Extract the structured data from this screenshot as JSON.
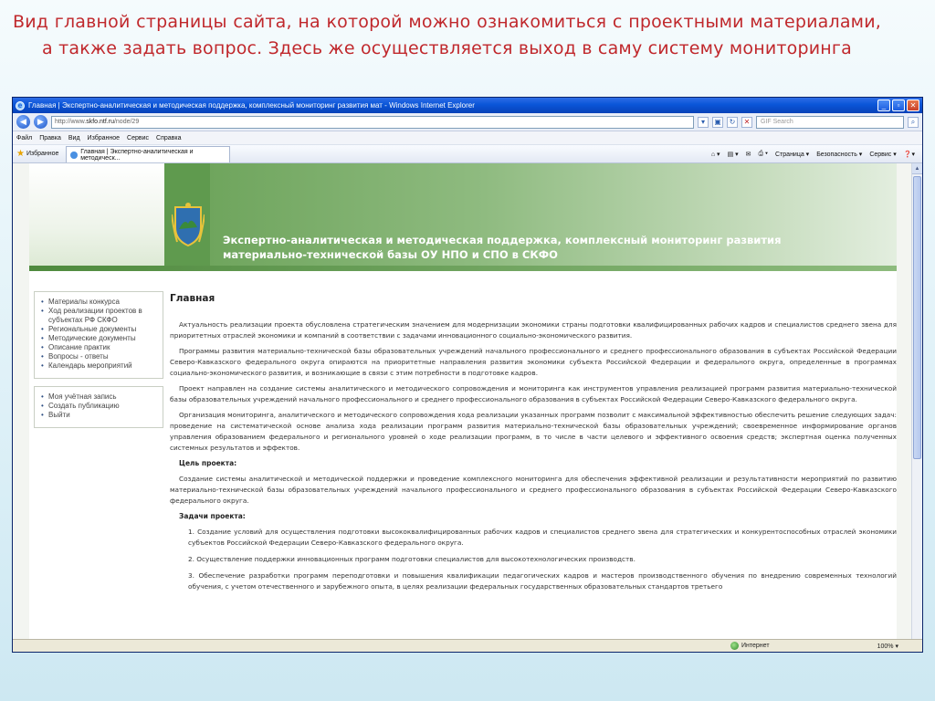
{
  "caption": "Вид главной страницы сайта, на которой можно ознакомиться с проектными материалами, а также задать вопрос. Здесь же осуществляется выход в саму систему мониторинга",
  "browser": {
    "title": "Главная | Экспертно-аналитическая и методическая поддержка, комплексный мониторинг развития мат - Windows Internet Explorer",
    "address_prefix": "http://www.",
    "address_host": "skfo.ntf.ru",
    "address_suffix": "/node/29",
    "search_placeholder": "GIF Search",
    "menu": [
      "Файл",
      "Правка",
      "Вид",
      "Избранное",
      "Сервис",
      "Справка"
    ],
    "favorites_label": "Избранное",
    "tab_label": "Главная | Экспертно-аналитическая и методическ...",
    "cmd": [
      "Страница ▾",
      "Безопасность ▾",
      "Сервис ▾"
    ],
    "status_zone": "Интернет",
    "status_zoom": "100% ▾"
  },
  "site": {
    "banner_title": "Экспертно-аналитическая и методическая поддержка, комплексный мониторинг развития материально-технической базы ОУ НПО и СПО в СКФО",
    "nav": [
      "Материалы конкурса",
      "Ход реализации проектов в субъектах РФ СКФО",
      "Региональные документы",
      "Методические документы",
      "Описание практик",
      "Вопросы - ответы",
      "Календарь мероприятий"
    ],
    "user_nav": [
      "Моя учётная запись",
      "Создать публикацию",
      "Выйти"
    ],
    "page_title": "Главная",
    "paragraphs": [
      "Актуальность реализации проекта обусловлена стратегическим значением для модернизации экономики страны подготовки квалифицированных рабочих кадров и специалистов среднего звена для приоритетных отраслей экономики и компаний в соответствии с задачами инновационного социально-экономического развития.",
      "Программы развития материально-технической базы образовательных учреждений начального профессионального и среднего профессионального образования в субъектах Российской Федерации Северо-Кавказского федерального округа опираются на приоритетные направления развития экономики субъекта Российской Федерации и федерального округа, определенные в программах социально-экономического развития, и возникающие в связи с этим потребности в подготовке кадров.",
      "Проект направлен на создание системы аналитического и методического сопровождения и мониторинга как инструментов управления реализацией программ развития материально-технической базы образовательных учреждений начального профессионального и среднего профессионального образования в субъектах Российской Федерации Северо-Кавказского федерального округа.",
      "Организация мониторинга, аналитического и методического сопровождения хода реализации указанных программ позволит с максимальной эффективностью обеспечить решение следующих задач: проведение на систематической основе анализа хода реализации программ развития материально-технической базы образовательных учреждений; своевременное информирование органов управления образованием федерального и регионального уровней о ходе реализации программ, в то числе в части целевого и эффективного освоения средств; экспертная оценка полученных системных результатов и эффектов."
    ],
    "goal_heading": "Цель проекта:",
    "goal_text": "Создание системы аналитической и методической поддержки и проведение комплексного мониторинга для обеспечения эффективной реализации и результативности мероприятий по развитию материально-технической базы образовательных учреждений начального профессионального и среднего профессионального образования в субъектах Российской Федерации Северо-Кавказского федерального округа.",
    "tasks_heading": "Задачи проекта:",
    "tasks": [
      "1. Создание условий для осуществления подготовки высококвалифицированных рабочих кадров и специалистов среднего звена для стратегических и конкурентоспособных отраслей экономики субъектов Российской Федерации Северо-Кавказского федерального округа.",
      "2. Осуществление поддержки инновационных программ подготовки специалистов для высокотехнологических производств.",
      "3. Обеспечение разработки программ переподготовки и повышения квалификации педагогических кадров и мастеров производственного обучения по внедрению современных технологий обучения, с учетом отечественного и зарубежного опыта, в целях реализации федеральных государственных образовательных стандартов третьего"
    ]
  }
}
